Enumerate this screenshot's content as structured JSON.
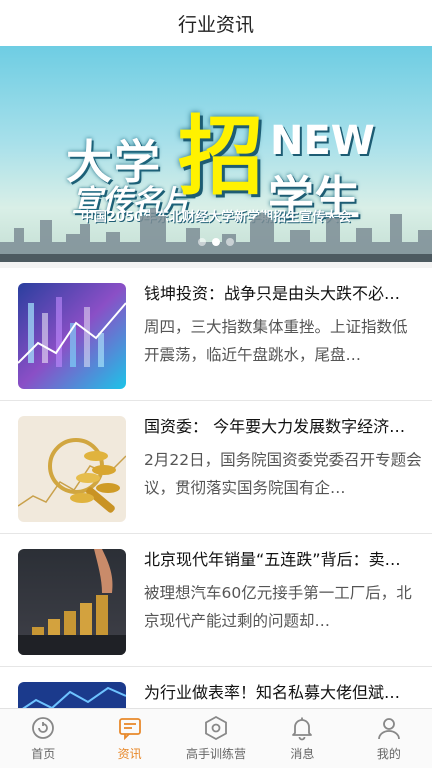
{
  "header": {
    "title": "行业资讯"
  },
  "banner": {
    "line1": "大学",
    "line1b": "宣传名片",
    "zhao": "招",
    "new": "NEW",
    "xuesheng": "学生",
    "subtitle": "中国2050年东北财经大学新学期招生宣传大会",
    "slide_count": 3,
    "active_slide": 1
  },
  "news": [
    {
      "title": "钱坤投资：战争只是由头大跌不必…",
      "summary": "周四，三大指数集体重挫。上证指数低开震荡，临近午盘跳水，尾盘…",
      "image": "stock-chart-image"
    },
    {
      "title": "国资委： 今年要大力发展数字经济…",
      "summary": "2月22日，国务院国资委党委召开专题会议，贯彻落实国务院国有企…",
      "image": "gold-coins-image"
    },
    {
      "title": "北京现代年销量“五连跌”背后：卖…",
      "summary": "被理想汽车60亿元接手第一工厂后，北京现代产能过剩的问题却…",
      "image": "coin-stacks-image"
    },
    {
      "title": "为行业做表率！知名私募大佬但斌…",
      "summary": "",
      "image": "market-chart-image"
    }
  ],
  "tabbar": {
    "active_color": "#e8892b",
    "items": [
      {
        "label": "首页",
        "icon": "home-icon"
      },
      {
        "label": "资讯",
        "icon": "news-icon"
      },
      {
        "label": "高手训练营",
        "icon": "training-icon"
      },
      {
        "label": "消息",
        "icon": "bell-icon"
      },
      {
        "label": "我的",
        "icon": "user-icon"
      }
    ]
  }
}
